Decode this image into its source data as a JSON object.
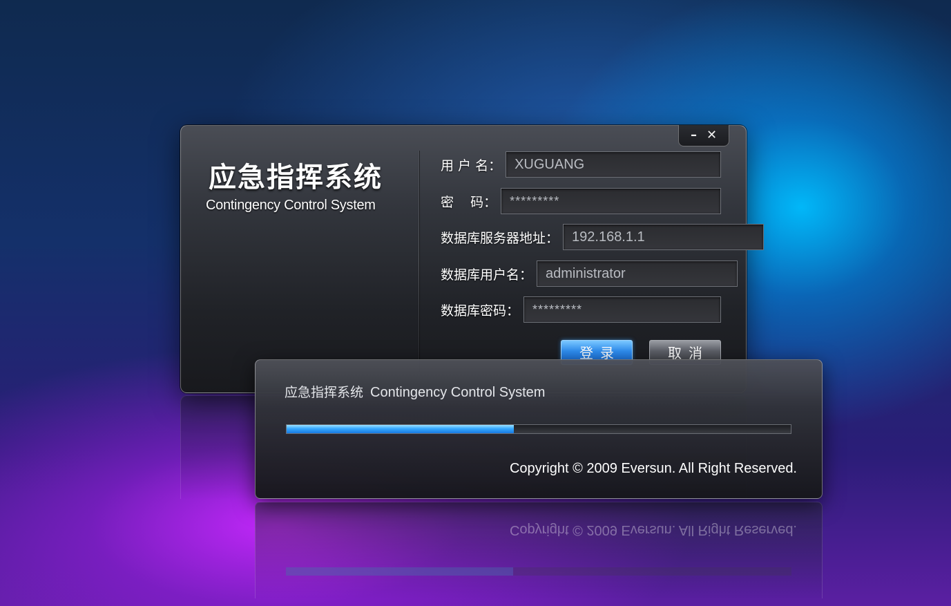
{
  "login": {
    "brand_cn": "应急指挥系统",
    "brand_en": "Contingency Control System",
    "window_controls": {
      "minimize_label": "–",
      "close_label": "✕"
    },
    "fields": {
      "username_label": "用 户 名：",
      "username_value": "XUGUANG",
      "password_label": "密    码：",
      "password_value": "*********",
      "db_server_label": "数据库服务器地址：",
      "db_server_value": "192.168.1.1",
      "db_user_label": "数据库用户名：",
      "db_user_value": "administrator",
      "db_password_label": "数据库密码：",
      "db_password_value": "*********"
    },
    "buttons": {
      "login_label": "登录",
      "cancel_label": "取消"
    }
  },
  "progress": {
    "title_cn": "应急指挥系统",
    "title_en": "Contingency Control System",
    "value": 0.45,
    "copyright": "Copyright © 2009 Eversun. All Right Reserved."
  },
  "colors": {
    "accent_blue": "#2f8ff2",
    "progress_fill": "#36a9ff"
  }
}
